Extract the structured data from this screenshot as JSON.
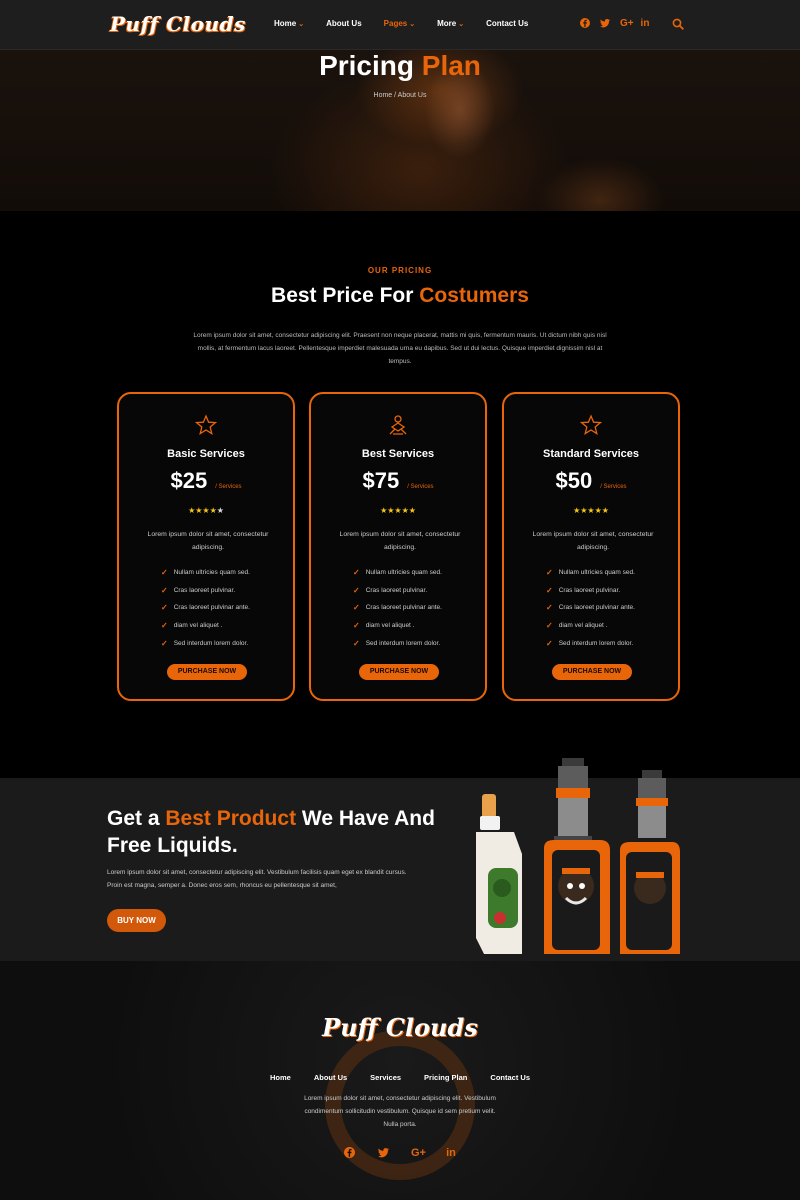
{
  "brand": {
    "name": "Puff Clouds",
    "accent": "#e8650a"
  },
  "nav": {
    "items": [
      {
        "label": "Home",
        "dropdown": true
      },
      {
        "label": "About Us",
        "dropdown": false
      },
      {
        "label": "Pages",
        "dropdown": true,
        "active": true
      },
      {
        "label": "More",
        "dropdown": true
      },
      {
        "label": "Contact Us",
        "dropdown": false
      }
    ],
    "social": [
      "facebook-icon",
      "twitter-icon",
      "google-plus-icon",
      "linkedin-icon"
    ],
    "search_icon": "search-icon"
  },
  "hero": {
    "title_main": "Pricing",
    "title_accent": "Plan",
    "breadcrumb": "Home / About Us"
  },
  "pricing": {
    "eyebrow": "OUR PRICING",
    "title_main": "Best Price For",
    "title_accent": "Costumers",
    "description": "Lorem ipsum dolor sit amet, consectetur adipiscing elit. Praesent non neque placerat, mattis mi quis, fermentum mauris. Ut dictum nibh quis nisl mollis, at fermentum lacus laoreet. Pellentesque imperdiet malesuada urna eu dapibus. Sed ut dui lectus. Quisque imperdiet dignissim nisl at tempus.",
    "plans": [
      {
        "icon": "star-outline-icon",
        "name": "Basic Services",
        "price": "$25",
        "per": "/ Services",
        "rating": 4,
        "description": "Lorem ipsum dolor sit amet, consectetur adipiscing.",
        "features": [
          "Nullam ultricies quam sed.",
          "Cras laoreet pulvinar.",
          "Cras laoreet pulvinar ante.",
          "diam vel aliquet .",
          "Sed interdum lorem dolor."
        ],
        "button": "PURCHASE NOW"
      },
      {
        "icon": "person-icon",
        "name": "Best Services",
        "price": "$75",
        "per": "/ Services",
        "rating": 5,
        "description": "Lorem ipsum dolor sit amet, consectetur adipiscing.",
        "features": [
          "Nullam ultricies quam sed.",
          "Cras laoreet pulvinar.",
          "Cras laoreet pulvinar ante.",
          "diam vel aliquet .",
          "Sed interdum lorem dolor."
        ],
        "button": "PURCHASE NOW"
      },
      {
        "icon": "star-outline-icon",
        "name": "Standard Services",
        "price": "$50",
        "per": "/ Services",
        "rating": 5,
        "description": "Lorem ipsum dolor sit amet, consectetur adipiscing.",
        "features": [
          "Nullam ultricies quam sed.",
          "Cras laoreet pulvinar.",
          "Cras laoreet pulvinar ante.",
          "diam vel aliquet .",
          "Sed interdum lorem dolor."
        ],
        "button": "PURCHASE NOW"
      }
    ]
  },
  "promo": {
    "title_pre": "Get a",
    "title_accent": "Best Product",
    "title_post": "We Have And Free Liquids.",
    "description": "Lorem ipsum dolor sit amet, consectetur adipiscing elit. Vestibulum facilisis quam eget ex blandit cursus. Proin est magna, semper a. Donec eros sem, rhoncus eu pellentesque sit amet,",
    "button": "BUY NOW"
  },
  "footer": {
    "logo": "Puff Clouds",
    "nav": [
      "Home",
      "About Us",
      "Services",
      "Pricing Plan",
      "Contact Us"
    ],
    "description": "Lorem ipsum dolor sit amet, consectetur adipiscing elit. Vestibulum condimentum sollicitudin vestibulum. Quisque id sem pretium velit. Nulla porta.",
    "social": [
      "facebook-icon",
      "twitter-icon",
      "google-plus-icon",
      "linkedin-icon"
    ]
  }
}
